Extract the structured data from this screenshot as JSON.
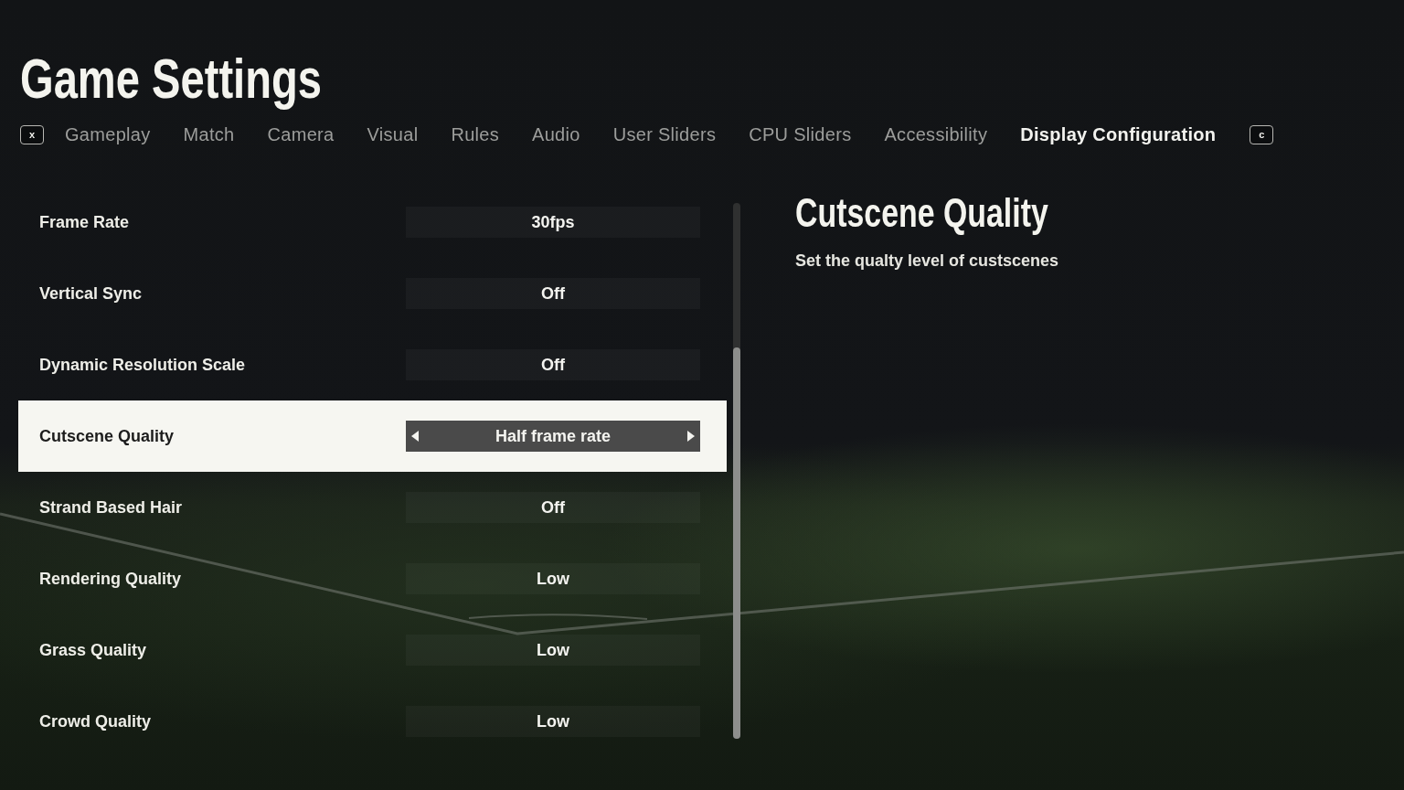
{
  "window": {
    "title": "Game Settings"
  },
  "tabs": {
    "prev_key": "x",
    "next_key": "c",
    "items": [
      {
        "label": "Gameplay",
        "selected": false
      },
      {
        "label": "Match",
        "selected": false
      },
      {
        "label": "Camera",
        "selected": false
      },
      {
        "label": "Visual",
        "selected": false
      },
      {
        "label": "Rules",
        "selected": false
      },
      {
        "label": "Audio",
        "selected": false
      },
      {
        "label": "User Sliders",
        "selected": false
      },
      {
        "label": "CPU Sliders",
        "selected": false
      },
      {
        "label": "Accessibility",
        "selected": false
      },
      {
        "label": "Display Configuration",
        "selected": true
      }
    ]
  },
  "settings": [
    {
      "label": "Frame Rate",
      "value": "30fps",
      "selected": false
    },
    {
      "label": "Vertical Sync",
      "value": "Off",
      "selected": false
    },
    {
      "label": "Dynamic Resolution Scale",
      "value": "Off",
      "selected": false
    },
    {
      "label": "Cutscene Quality",
      "value": "Half frame rate",
      "selected": true
    },
    {
      "label": "Strand Based Hair",
      "value": "Off",
      "selected": false
    },
    {
      "label": "Rendering Quality",
      "value": "Low",
      "selected": false
    },
    {
      "label": "Grass Quality",
      "value": "Low",
      "selected": false
    },
    {
      "label": "Crowd Quality",
      "value": "Low",
      "selected": false
    }
  ],
  "detail": {
    "title": "Cutscene Quality",
    "description": "Set the qualty level of custscenes"
  }
}
